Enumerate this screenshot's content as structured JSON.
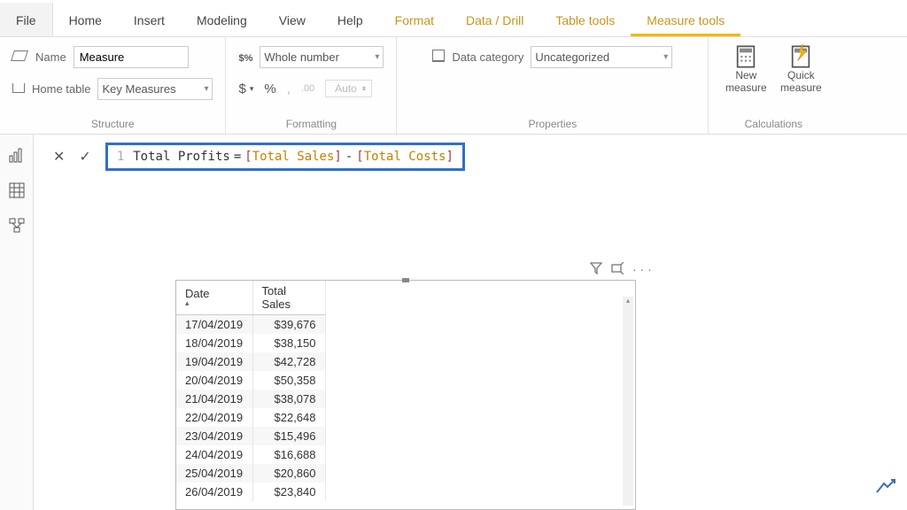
{
  "menu": {
    "file": "File",
    "home": "Home",
    "insert": "Insert",
    "modeling": "Modeling",
    "view": "View",
    "help": "Help",
    "format": "Format",
    "data_drill": "Data / Drill",
    "table_tools": "Table tools",
    "measure_tools": "Measure tools"
  },
  "ribbon": {
    "structure": {
      "name_label": "Name",
      "name_value": "Measure",
      "home_table_label": "Home table",
      "home_table_value": "Key Measures",
      "title": "Structure"
    },
    "formatting": {
      "format_value": "Whole number",
      "dollar": "$",
      "percent": "%",
      "comma": ",",
      "decimals": ".00",
      "auto": "Auto",
      "title": "Formatting"
    },
    "properties": {
      "data_category_label": "Data category",
      "data_category_value": "Uncategorized",
      "title": "Properties"
    },
    "calculations": {
      "new_measure": "New measure",
      "quick_measure": "Quick measure",
      "title": "Calculations"
    }
  },
  "formula": {
    "line": "1",
    "name": "Total Profits",
    "eq": " = ",
    "col1": "Total Sales",
    "minus": " - ",
    "col2": "Total Costs"
  },
  "table": {
    "headers": {
      "date": "Date",
      "sales": "Total Sales"
    },
    "rows": [
      {
        "date": "17/04/2019",
        "sales": "$39,676"
      },
      {
        "date": "18/04/2019",
        "sales": "$38,150"
      },
      {
        "date": "19/04/2019",
        "sales": "$42,728"
      },
      {
        "date": "20/04/2019",
        "sales": "$50,358"
      },
      {
        "date": "21/04/2019",
        "sales": "$38,078"
      },
      {
        "date": "22/04/2019",
        "sales": "$22,648"
      },
      {
        "date": "23/04/2019",
        "sales": "$15,496"
      },
      {
        "date": "24/04/2019",
        "sales": "$16,688"
      },
      {
        "date": "25/04/2019",
        "sales": "$20,860"
      },
      {
        "date": "26/04/2019",
        "sales": "$23,840"
      }
    ]
  }
}
